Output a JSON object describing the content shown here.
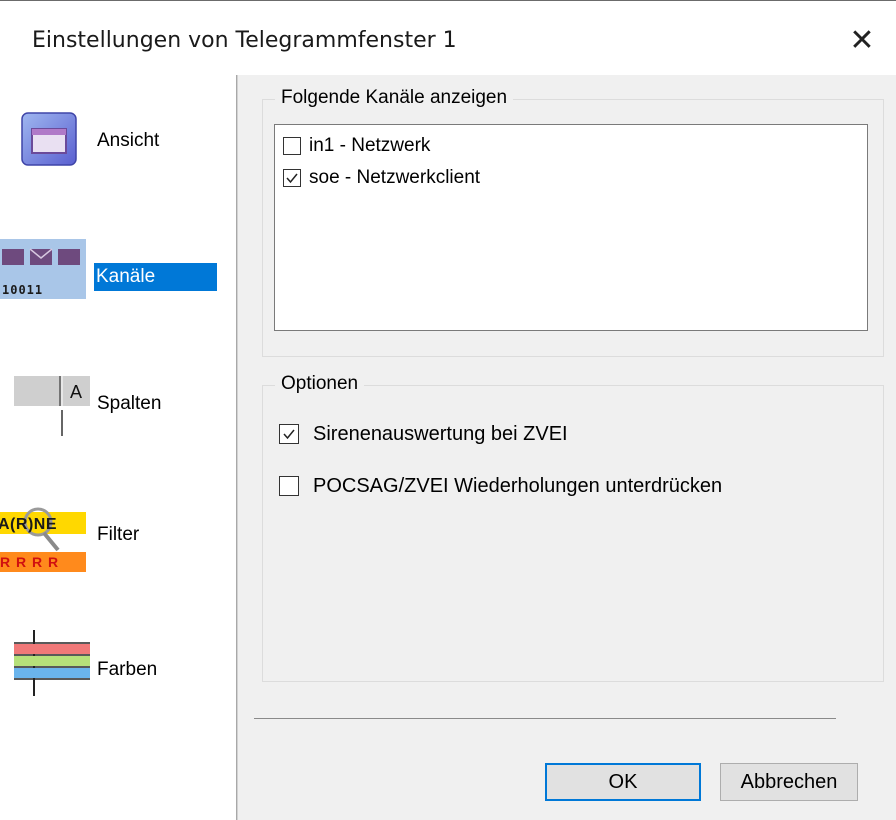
{
  "window": {
    "title": "Einstellungen von Telegrammfenster 1",
    "close_symbol": "✕"
  },
  "nav": {
    "items": [
      {
        "label": "Ansicht",
        "icon": "window-icon"
      },
      {
        "label": "Kanäle",
        "icon": "channels-icon",
        "selected": true
      },
      {
        "label": "Spalten",
        "icon": "columns-icon"
      },
      {
        "label": "Filter",
        "icon": "filter-icon"
      },
      {
        "label": "Farben",
        "icon": "colors-icon"
      }
    ],
    "channels_icon_text": "10011",
    "filter_icon_top_text": "A(R)NE",
    "filter_icon_bottom_text": "R R R R"
  },
  "channels_group": {
    "legend": "Folgende Kanäle anzeigen",
    "items": [
      {
        "label": "in1 - Netzwerk",
        "checked": false
      },
      {
        "label": "soe - Netzwerkclient",
        "checked": true
      }
    ]
  },
  "options_group": {
    "legend": "Optionen",
    "items": [
      {
        "label": "Sirenenauswertung bei ZVEI",
        "checked": true
      },
      {
        "label": "POCSAG/ZVEI Wiederholungen unterdrücken",
        "checked": false
      }
    ]
  },
  "buttons": {
    "ok": "OK",
    "cancel": "Abbrechen"
  },
  "colors": {
    "accent": "#0078d7",
    "panel": "#f0f0f0",
    "button": "#e1e1e1"
  }
}
